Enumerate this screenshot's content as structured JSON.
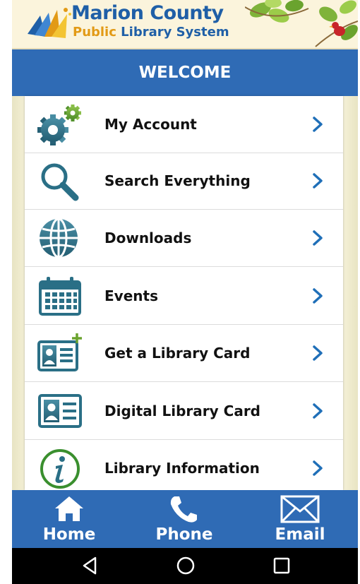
{
  "header": {
    "logo_line1": "Marion County",
    "logo_line2_public": "Public",
    "logo_line2_rest": " Library System"
  },
  "title_bar": {
    "title": "WELCOME"
  },
  "menu": {
    "items": [
      {
        "label": "My Account",
        "icon": "gears-icon"
      },
      {
        "label": "Search Everything",
        "icon": "magnifier-icon"
      },
      {
        "label": "Downloads",
        "icon": "globe-icon"
      },
      {
        "label": "Events",
        "icon": "calendar-icon"
      },
      {
        "label": "Get a Library Card",
        "icon": "id-card-plus-icon"
      },
      {
        "label": "Digital Library Card",
        "icon": "id-card-icon"
      },
      {
        "label": "Library Information",
        "icon": "info-icon"
      }
    ]
  },
  "bottom_nav": {
    "home": "Home",
    "phone": "Phone",
    "email": "Email"
  },
  "colors": {
    "accent_blue": "#2f6bb5",
    "icon_teal": "#2a6f86",
    "chevron_blue": "#1f6fb8"
  }
}
